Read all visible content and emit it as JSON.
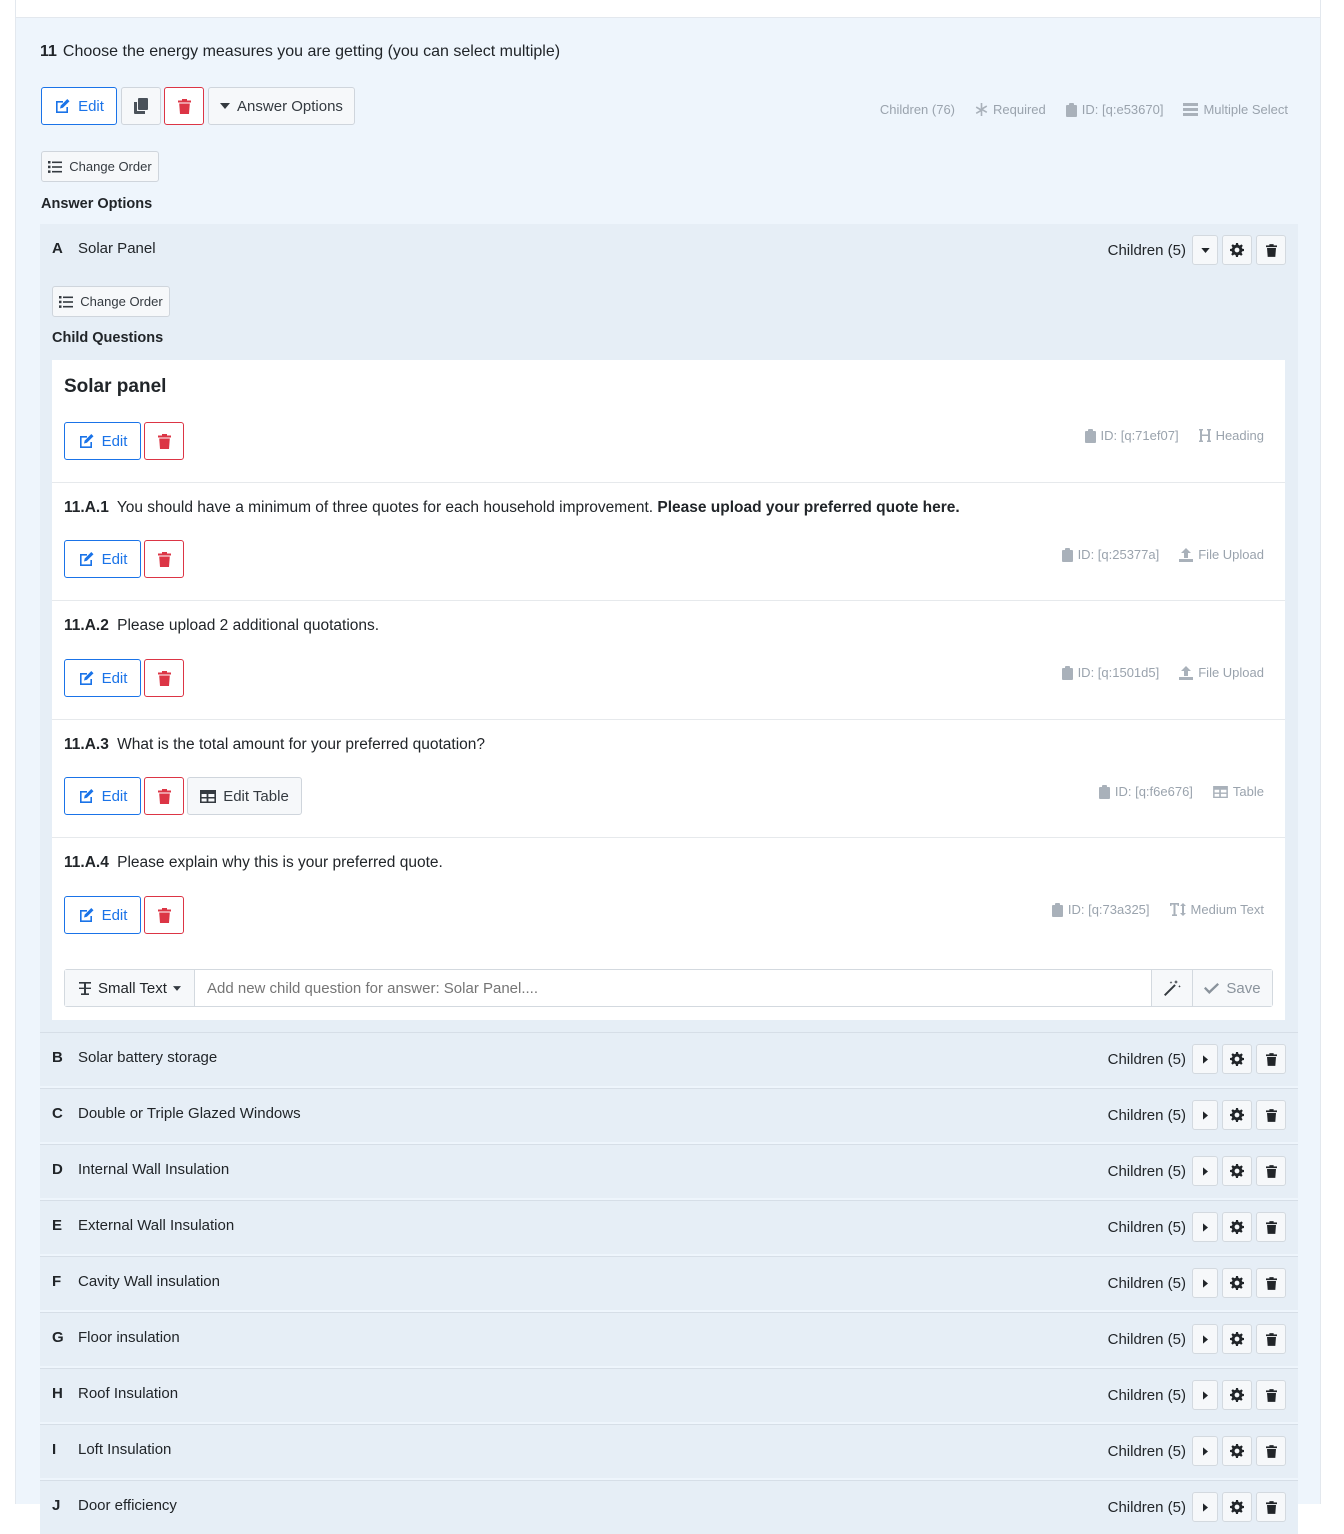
{
  "question": {
    "number": "11",
    "text": "Choose the energy measures you are getting (you can select multiple)",
    "edit_label": "Edit",
    "answer_options_label": "Answer Options",
    "change_order_label": "Change Order",
    "meta": {
      "children": "Children (76)",
      "required": "Required",
      "id": "ID: [q:e53670]",
      "type": "Multiple Select"
    },
    "answer_options_heading": "Answer Options"
  },
  "option_a": {
    "letter": "A",
    "label": "Solar Panel",
    "children": "Children (5)",
    "change_order_label": "Change Order",
    "child_questions_heading": "Child Questions",
    "children_list": [
      {
        "number": "",
        "title": "Solar panel",
        "id": "ID: [q:71ef07]",
        "type": "Heading",
        "edit": "Edit"
      },
      {
        "number": "11.A.1",
        "title": "You should have a minimum of three quotes for each household improvement.",
        "title_bold": "Please upload your preferred quote here.",
        "id": "ID: [q:25377a]",
        "type": "File Upload",
        "edit": "Edit"
      },
      {
        "number": "11.A.2",
        "title": "Please upload 2 additional quotations.",
        "id": "ID: [q:1501d5]",
        "type": "File Upload",
        "edit": "Edit"
      },
      {
        "number": "11.A.3",
        "title": "What is the total amount for your preferred quotation?",
        "id": "ID: [q:f6e676]",
        "type": "Table",
        "edit": "Edit",
        "extra_button": "Edit Table"
      },
      {
        "number": "11.A.4",
        "title": "Please explain why this is your preferred quote.",
        "id": "ID: [q:73a325]",
        "type": "Medium Text",
        "edit": "Edit"
      }
    ],
    "adder": {
      "type_label": "Small Text",
      "placeholder": "Add new child question for answer: Solar Panel....",
      "save_label": "Save"
    }
  },
  "other_options": [
    {
      "letter": "B",
      "label": "Solar battery storage",
      "children": "Children (5)"
    },
    {
      "letter": "C",
      "label": "Double or Triple Glazed Windows",
      "children": "Children (5)"
    },
    {
      "letter": "D",
      "label": "Internal Wall Insulation",
      "children": "Children (5)"
    },
    {
      "letter": "E",
      "label": "External Wall Insulation",
      "children": "Children (5)"
    },
    {
      "letter": "F",
      "label": "Cavity Wall insulation",
      "children": "Children (5)"
    },
    {
      "letter": "G",
      "label": "Floor insulation",
      "children": "Children (5)"
    },
    {
      "letter": "H",
      "label": "Roof Insulation",
      "children": "Children (5)"
    },
    {
      "letter": "I",
      "label": "Loft Insulation",
      "children": "Children (5)"
    },
    {
      "letter": "J",
      "label": "Door efficiency",
      "children": "Children (5)"
    }
  ],
  "colors": {
    "primary": "#1a73e8",
    "danger": "#dc3545",
    "muted": "#9aa3ad",
    "panel": "#eef5fc",
    "option_bg": "#e6eef6"
  },
  "icons": [
    "edit-icon",
    "copy-icon",
    "trash-icon",
    "caret-down-icon",
    "caret-right-icon",
    "list-icon",
    "asterisk-icon",
    "clipboard-icon",
    "table-icon",
    "heading-icon",
    "upload-icon",
    "text-height-icon",
    "gear-icon",
    "magic-wand-icon",
    "check-icon",
    "small-text-icon"
  ]
}
